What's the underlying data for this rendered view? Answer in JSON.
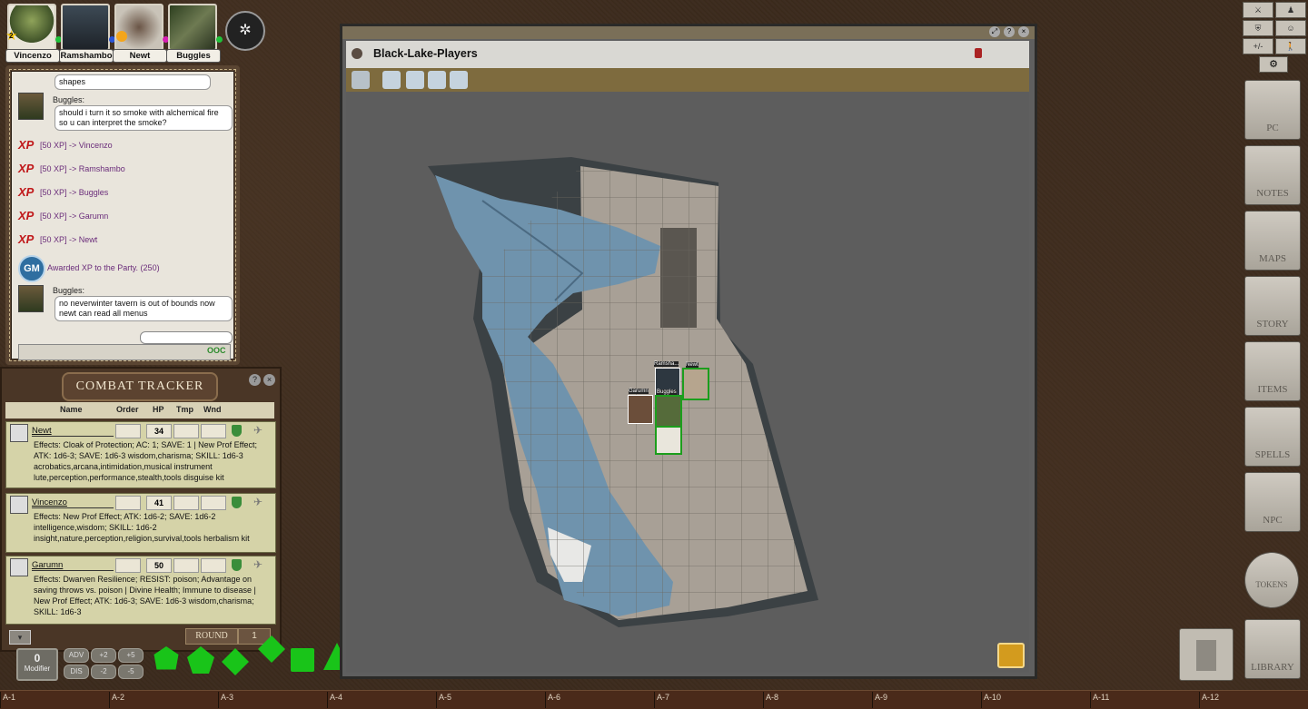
{
  "party": [
    {
      "name": "Vincenzo",
      "badge": "2",
      "dot": "#1ec23a"
    },
    {
      "name": "Ramshambo",
      "dot": "#2a55d8"
    },
    {
      "name": "Newt",
      "dot": "#d81fb4"
    },
    {
      "name": "Buggles",
      "dot": "#1ec23a"
    }
  ],
  "chat": {
    "prev_bubble": "shapes",
    "msg1_speaker": "Buggles:",
    "msg1_text": "should i turn it so smoke with alchemical fire so u can interpret the smoke?",
    "xp": [
      "[50 XP] -> Vincenzo",
      "[50 XP] -> Ramshambo",
      "[50 XP] -> Buggles",
      "[50 XP] -> Garumn",
      "[50 XP] -> Newt"
    ],
    "xp_label": "XP",
    "gm_label": "GM",
    "gm_text": "Awarded XP to the Party. (250)",
    "msg2_speaker": "Buggles:",
    "msg2_text": "no neverwinter tavern is out of bounds now newt can read all menus",
    "mode": "OOC"
  },
  "combat": {
    "title": "COMBAT TRACKER",
    "columns": [
      "Name",
      "Order",
      "HP",
      "Tmp",
      "Wnd"
    ],
    "rows": [
      {
        "name": "Newt",
        "hp": "34",
        "effects": "Effects: Cloak of Protection; AC: 1; SAVE: 1 | New Prof Effect; ATK: 1d6-3; SAVE: 1d6-3 wisdom,charisma; SKILL: 1d6-3 acrobatics,arcana,intimidation,musical instrument lute,perception,performance,stealth,tools disguise kit"
      },
      {
        "name": "Vincenzo",
        "hp": "41",
        "effects": "Effects: New Prof Effect; ATK: 1d6-2; SAVE: 1d6-2 intelligence,wisdom; SKILL: 1d6-2 insight,nature,perception,religion,survival,tools herbalism kit"
      },
      {
        "name": "Garumn",
        "hp": "50",
        "effects": "Effects: Dwarven Resilience; RESIST: poison; Advantage on saving throws vs. poison | Divine Health; Immune to disease | New Prof Effect; ATK: 1d6-3; SAVE: 1d6-3 wisdom,charisma; SKILL: 1d6-3"
      }
    ],
    "round_label": "ROUND",
    "round_value": "1"
  },
  "modifier": {
    "label": "Modifier",
    "value": "0",
    "buttons": [
      "ADV",
      "+2",
      "+5",
      "DIS",
      "-2",
      "-5"
    ]
  },
  "dice": [
    "d4",
    "d6",
    "d8",
    "d10",
    "d12",
    "d20"
  ],
  "map": {
    "title": "Black-Lake-Players",
    "tokens": [
      "Ramsha...",
      "Newt",
      "Garumn",
      "Buggles"
    ]
  },
  "sidebar": [
    "PC",
    "NOTES",
    "MAPS",
    "STORY",
    "ITEMS",
    "SPELLS",
    "NPC",
    "TOKENS",
    "LIBRARY"
  ],
  "top_icons": [
    "+/-"
  ],
  "hotkeys": [
    "A-1",
    "A-2",
    "A-3",
    "A-4",
    "A-5",
    "A-6",
    "A-7",
    "A-8",
    "A-9",
    "A-10",
    "A-11",
    "A-12"
  ]
}
